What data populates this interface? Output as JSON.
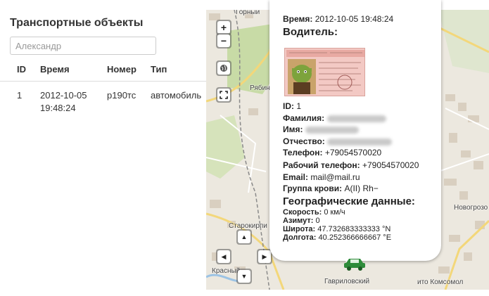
{
  "left_panel": {
    "title": "Транспортные объекты",
    "search": {
      "value": "",
      "placeholder": "Александр"
    },
    "columns": [
      "ID",
      "Время",
      "Номер",
      "Тип"
    ],
    "rows": [
      {
        "id": "1",
        "time_date": "2012-10-05",
        "time_clock": "19:48:24",
        "number": "р190тс",
        "type": "автомобиль"
      }
    ]
  },
  "map": {
    "controls": {
      "zoom_in": "+",
      "zoom_out": "−",
      "pan_up": "▲",
      "pan_down": "▼",
      "pan_left": "◀",
      "pan_right": "▶"
    },
    "labels": {
      "gorny": "Горный",
      "rybin": "Рябин",
      "starokirp": "Старокирпи",
      "krasny": "Красный",
      "gavrilovsky": "Гавриловский",
      "novogrozov": "Новогрозо",
      "komsomol": "ито Комсомол"
    }
  },
  "popup": {
    "time_label": "Время:",
    "time_value": "2012-10-05 19:48:24",
    "driver_heading": "Водитель:",
    "id_label": "ID:",
    "id_value": "1",
    "surname_label": "Фамилия:",
    "name_label": "Имя:",
    "patronymic_label": "Отчество:",
    "phone_label": "Телефон:",
    "phone_value": "+79054570020",
    "work_phone_label": "Рабочий телефон:",
    "work_phone_value": "+79054570020",
    "email_label": "Email:",
    "email_value": "mail@mail.ru",
    "blood_label": "Группа крови:",
    "blood_value": "A(II) Rh−",
    "geo_heading": "Географические данные:",
    "speed_label": "Скорость:",
    "speed_value": "0 км/ч",
    "azimuth_label": "Азимут:",
    "azimuth_value": "0",
    "lat_label": "Широта:",
    "lat_value": "47.732683333333 °N",
    "lon_label": "Долгота:",
    "lon_value": "40.252366666667 °E"
  },
  "colors": {
    "map_bg": "#ece8df",
    "park_green": "#c8dba6",
    "road_yellow": "#f3d77a",
    "popup_bg": "#ffffff",
    "vehicle_marker": "#2e8b3a"
  }
}
